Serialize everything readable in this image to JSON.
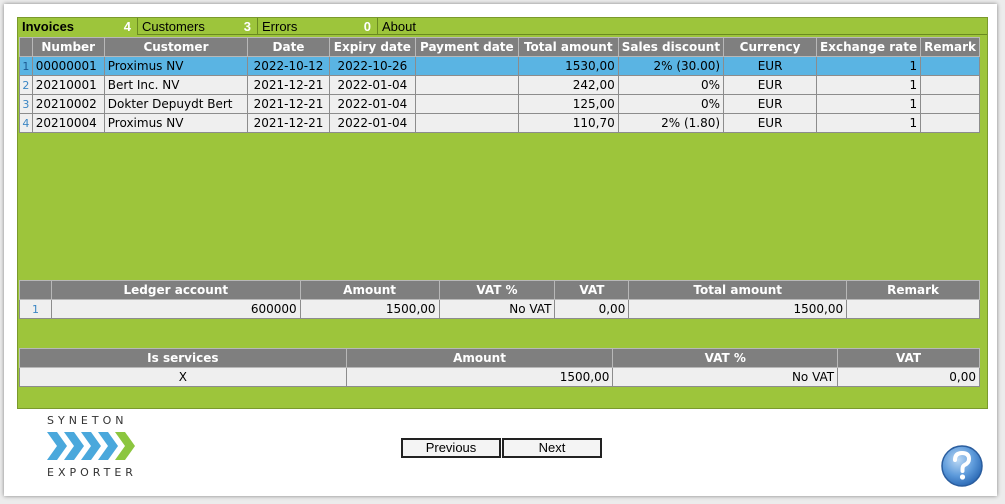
{
  "tabs": [
    {
      "label": "Invoices",
      "count": "4"
    },
    {
      "label": "Customers",
      "count": "3"
    },
    {
      "label": "Errors",
      "count": "0"
    },
    {
      "label": "About",
      "count": ""
    }
  ],
  "invoices": {
    "headers": [
      "Number",
      "Customer",
      "Date",
      "Expiry date",
      "Payment date",
      "Total amount",
      "Sales discount",
      "Currency",
      "Exchange rate",
      "Remark"
    ],
    "rows": [
      {
        "n": "1",
        "number": "00000001",
        "customer": "Proximus NV",
        "date": "2022-10-12",
        "expiry": "2022-10-26",
        "payment": "",
        "total": "1530,00",
        "discount": "2% (30.00)",
        "currency": "EUR",
        "rate": "1",
        "remark": ""
      },
      {
        "n": "2",
        "number": "20210001",
        "customer": "Bert Inc. NV",
        "date": "2021-12-21",
        "expiry": "2022-01-04",
        "payment": "",
        "total": "242,00",
        "discount": "0%",
        "currency": "EUR",
        "rate": "1",
        "remark": ""
      },
      {
        "n": "3",
        "number": "20210002",
        "customer": "Dokter Depuydt Bert",
        "date": "2021-12-21",
        "expiry": "2022-01-04",
        "payment": "",
        "total": "125,00",
        "discount": "0%",
        "currency": "EUR",
        "rate": "1",
        "remark": ""
      },
      {
        "n": "4",
        "number": "20210004",
        "customer": "Proximus NV",
        "date": "2021-12-21",
        "expiry": "2022-01-04",
        "payment": "",
        "total": "110,70",
        "discount": "2% (1.80)",
        "currency": "EUR",
        "rate": "1",
        "remark": ""
      }
    ]
  },
  "ledger": {
    "headers": [
      "Ledger account",
      "Amount",
      "VAT %",
      "VAT",
      "Total amount",
      "Remark"
    ],
    "rows": [
      {
        "n": "1",
        "account": "600000",
        "amount": "1500,00",
        "vat_pct": "No VAT",
        "vat": "0,00",
        "total": "1500,00",
        "remark": ""
      }
    ]
  },
  "vat_summary": {
    "headers": [
      "Is services",
      "Amount",
      "VAT %",
      "VAT"
    ],
    "rows": [
      {
        "services": "X",
        "amount": "1500,00",
        "vat_pct": "No VAT",
        "vat": "0,00"
      }
    ]
  },
  "logo": {
    "line1": "SYNETON",
    "line2": "EXPORTER"
  },
  "buttons": {
    "previous": "Previous",
    "next": "Next"
  },
  "colors": {
    "panel": "#9dc53b",
    "selected_row": "#5ab4e3",
    "header": "#7f7f7f",
    "chevron_blue": "#4aa8dc",
    "chevron_green": "#8cc63f"
  },
  "icons": {
    "help": "question-mark-circle"
  }
}
